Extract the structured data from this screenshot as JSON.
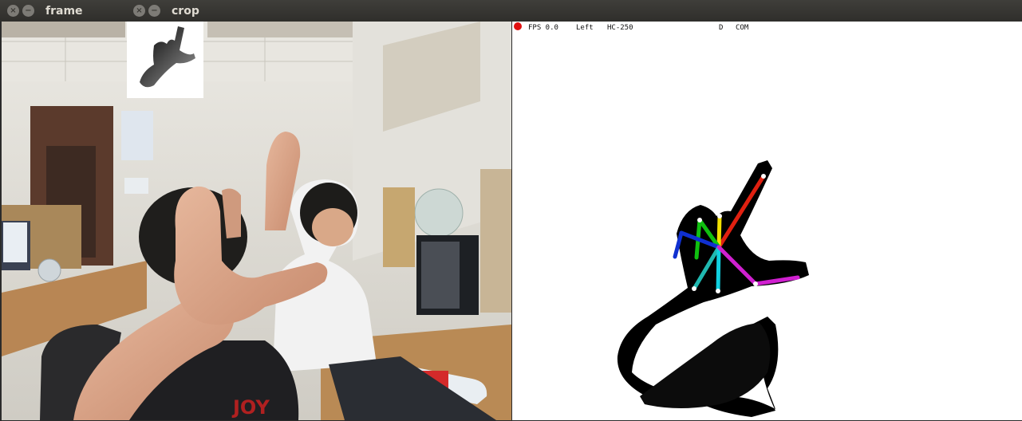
{
  "windows": {
    "frame": {
      "title": "frame",
      "close": "×",
      "minimize": "−"
    },
    "crop": {
      "title": "crop",
      "close": "×",
      "minimize": "−"
    }
  },
  "hud": {
    "fps": "FPS 0.0",
    "hand": "Left",
    "sensor": "HC-250",
    "mode": "D",
    "com": "COM"
  },
  "colors": {
    "indicator": "#e01010",
    "skeleton_red": "#e02010",
    "skeleton_yellow": "#f2e000",
    "skeleton_green": "#10c010",
    "skeleton_blue": "#1030d0",
    "skeleton_cyan": "#10d0e0",
    "skeleton_teal": "#20b8b0",
    "skeleton_magenta": "#d020d0"
  }
}
